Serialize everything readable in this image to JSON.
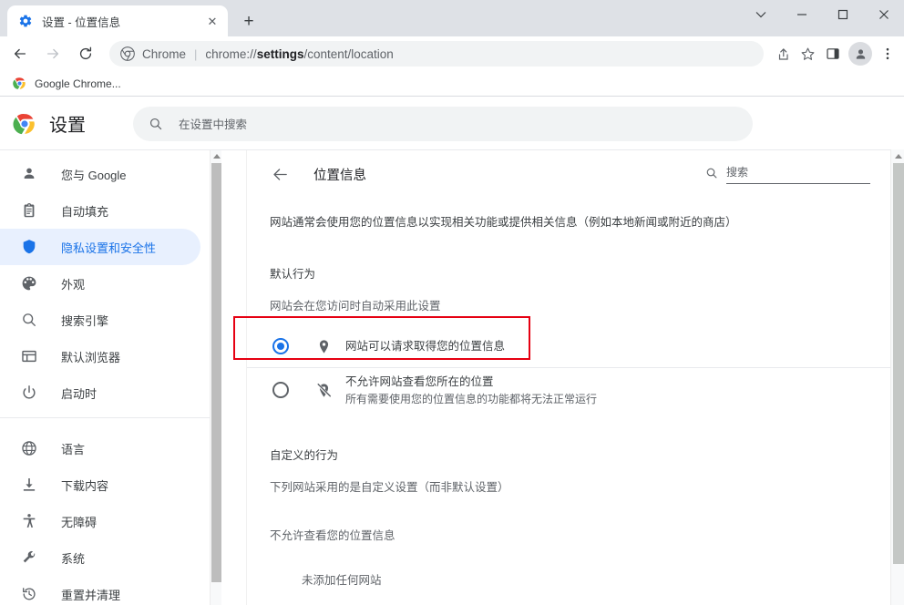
{
  "window": {
    "tab": {
      "title": "设置 - 位置信息",
      "favicon": "gear-icon",
      "close_label": "✕"
    },
    "new_tab_label": "+",
    "controls": {
      "minimize": "—",
      "maximize": "▢",
      "close": "✕",
      "tab_search": "⌄"
    }
  },
  "toolbar": {
    "back": "←",
    "forward": "→",
    "reload": "⟳",
    "omnibox": {
      "scheme_label": "Chrome",
      "separator": "|",
      "url_prefix": "chrome://",
      "url_bold": "settings",
      "url_suffix": "/content/location",
      "full_url": "chrome://settings/content/location"
    },
    "share_icon": "share-icon",
    "bookmark_icon": "star-icon",
    "sidepanel_icon": "side-panel-icon",
    "profile_icon": "profile-avatar-icon",
    "menu_icon": "three-dot-menu-icon"
  },
  "bookmarks_bar": {
    "items": [
      {
        "label": "Google Chrome...",
        "icon": "chrome-logo-icon"
      }
    ]
  },
  "settings_header": {
    "logo": "chrome-logo-icon",
    "title": "设置",
    "search": {
      "placeholder": "在设置中搜索",
      "value": "",
      "icon": "search-icon"
    }
  },
  "sidebar": {
    "groups": [
      {
        "items": [
          {
            "label": "您与 Google",
            "icon": "person-icon",
            "active": false
          },
          {
            "label": "自动填充",
            "icon": "clipboard-icon",
            "active": false
          },
          {
            "label": "隐私设置和安全性",
            "icon": "shield-icon",
            "active": true
          },
          {
            "label": "外观",
            "icon": "palette-icon",
            "active": false
          },
          {
            "label": "搜索引擎",
            "icon": "search-icon",
            "active": false
          },
          {
            "label": "默认浏览器",
            "icon": "browser-window-icon",
            "active": false
          },
          {
            "label": "启动时",
            "icon": "power-icon",
            "active": false
          }
        ]
      },
      {
        "items": [
          {
            "label": "语言",
            "icon": "globe-icon",
            "active": false
          },
          {
            "label": "下载内容",
            "icon": "download-icon",
            "active": false
          },
          {
            "label": "无障碍",
            "icon": "accessibility-icon",
            "active": false
          },
          {
            "label": "系统",
            "icon": "wrench-icon",
            "active": false
          },
          {
            "label": "重置并清理",
            "icon": "history-restore-icon",
            "active": false
          }
        ]
      }
    ]
  },
  "content": {
    "back_arrow": "←",
    "page_title": "位置信息",
    "search": {
      "placeholder": "搜索",
      "value": "",
      "icon": "search-icon"
    },
    "description": "网站通常会使用您的位置信息以实现相关功能或提供相关信息（例如本地新闻或附近的商店）",
    "default_behavior": {
      "heading": "默认行为",
      "subheading": "网站会在您访问时自动采用此设置",
      "options": [
        {
          "title": "网站可以请求取得您的位置信息",
          "description": "",
          "icon": "location-pin-icon",
          "selected": true,
          "highlighted": true
        },
        {
          "title": "不允许网站查看您所在的位置",
          "description": "所有需要使用您的位置信息的功能都将无法正常运行",
          "icon": "location-pin-off-icon",
          "selected": false,
          "highlighted": false
        }
      ]
    },
    "custom_behavior": {
      "heading": "自定义的行为",
      "subheading": "下列网站采用的是自定义设置（而非默认设置）",
      "blocked_section_label": "不允许查看您的位置信息",
      "empty_message": "未添加任何网站"
    }
  },
  "colors": {
    "accent": "#1a73e8",
    "accent_bg": "#e8f0fe",
    "annotation": "#e60012",
    "toolbar_bg": "#dee1e6",
    "field_bg": "#f1f3f4",
    "text_primary": "#202124",
    "text_secondary": "#5f6368"
  }
}
